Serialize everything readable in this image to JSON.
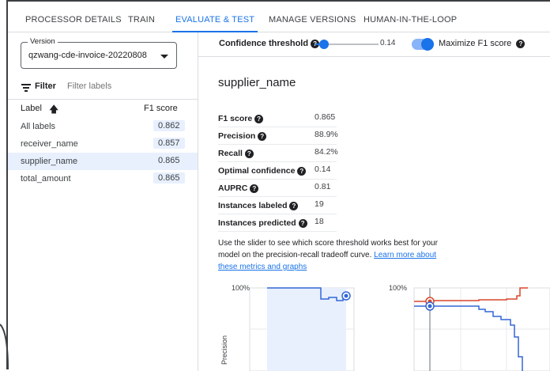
{
  "tabs": [
    {
      "label": "PROCESSOR DETAILS"
    },
    {
      "label": "TRAIN"
    },
    {
      "label": "EVALUATE & TEST",
      "active": true
    },
    {
      "label": "MANAGE VERSIONS"
    },
    {
      "label": "HUMAN-IN-THE-LOOP"
    }
  ],
  "left": {
    "version_label": "Version",
    "version_value": "qzwang-cde-invoice-20220808",
    "filter_label": "Filter",
    "filter_placeholder": "Filter labels",
    "label_header": "Label",
    "f1_header": "F1 score",
    "rows": [
      {
        "name": "All labels",
        "f1": "0.862"
      },
      {
        "name": "receiver_name",
        "f1": "0.857"
      },
      {
        "name": "supplier_name",
        "f1": "0.865",
        "selected": true
      },
      {
        "name": "total_amount",
        "f1": "0.865"
      }
    ]
  },
  "confidence": {
    "label": "Confidence threshold",
    "value": "0.14",
    "slider_fraction": 0.14,
    "toggle_on": true,
    "maximize_label": "Maximize F1 score"
  },
  "detail": {
    "title": "supplier_name",
    "metrics": [
      {
        "key": "F1 score",
        "value": "0.865"
      },
      {
        "key": "Precision",
        "value": "88.9%"
      },
      {
        "key": "Recall",
        "value": "84.2%"
      },
      {
        "key": "Optimal confidence",
        "value": "0.14"
      },
      {
        "key": "AUPRC",
        "value": "0.81"
      },
      {
        "key": "Instances labeled",
        "value": "19"
      },
      {
        "key": "Instances predicted",
        "value": "18"
      }
    ],
    "description_text": "Use the slider to see which score threshold works best for your model on the precision-recall tradeoff curve. ",
    "description_link": "Learn more about these metrics and graphs"
  },
  "charts": {
    "left_y_top": "100%",
    "left_y_label": "Precision",
    "right_y_top": "100%"
  },
  "colors": {
    "accent": "#1a73e8",
    "precision_line": "#3367d6",
    "recall_line": "#d9472b",
    "selected_row": "#e8f0fe"
  }
}
